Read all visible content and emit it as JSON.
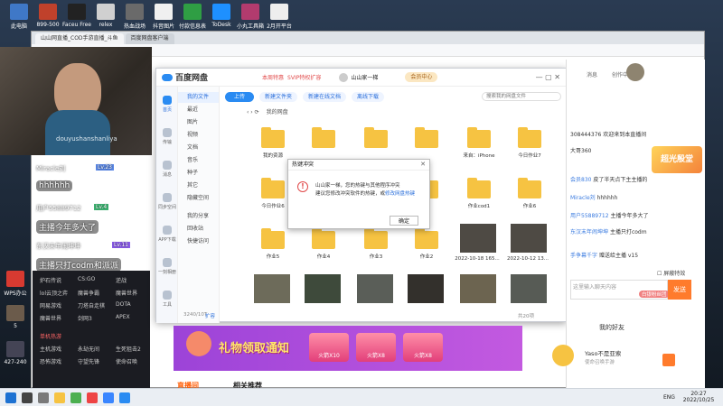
{
  "desktop": {
    "top_icons": [
      {
        "label": "此电脑",
        "color": "#3f78c7"
      },
      {
        "label": "899-500",
        "color": "#c0412b"
      },
      {
        "label": "Faceu Free",
        "color": "#222"
      },
      {
        "label": "relex",
        "color": "#d0d0d0"
      },
      {
        "label": "热血战场",
        "color": "#6a6a6a"
      },
      {
        "label": "抖音图片",
        "color": "#f0f0f0"
      },
      {
        "label": "付款信息表格",
        "color": "#2f9e44"
      },
      {
        "label": "ToDesk",
        "color": "#1e90ff"
      },
      {
        "label": "小丸工具箱",
        "color": "#b23b6e"
      },
      {
        "label": "2月开平台",
        "color": "#eeeeee"
      }
    ],
    "left_icons": [
      {
        "label": "WPS办公",
        "color": "#d73a31"
      },
      {
        "label": "5",
        "color": "#6b5b4b"
      },
      {
        "label": "427-240",
        "color": "#445"
      }
    ]
  },
  "browser": {
    "tabs": [
      {
        "label": "山山网直播_COD手游直播_斗鱼"
      },
      {
        "label": "百度网盘客户端"
      }
    ]
  },
  "stream_overlay": {
    "webcam_text": "douyushanshanliya",
    "chat": [
      {
        "user": "Miracle刘",
        "badge": "Lv.23",
        "text": "hhhhhh"
      },
      {
        "user": "用户55889712",
        "badge": "Lv.4",
        "text": "主播今年多大了"
      },
      {
        "user": "东汉末年闹坤坤",
        "badge": "Lv.11",
        "text": "主播只打codm和派派"
      }
    ]
  },
  "game_nav": {
    "rows": [
      [
        "炉石传说",
        "CS:GO",
        "逆战"
      ],
      [
        "lol云顶之弈",
        "魔兽争霸",
        "魔兽世界"
      ],
      [
        "网易游戏",
        "刀塔自走棋",
        "DOTA"
      ],
      [
        "魔兽世界",
        "剑网3",
        "APEX"
      ]
    ],
    "section": "单机热游",
    "rows2": [
      [
        "主机游戏",
        "永劫无间",
        "生死狙击2"
      ],
      [
        "恐怖游戏",
        "守望先锋",
        "使命召唤"
      ]
    ]
  },
  "pan": {
    "title": "百度网盘",
    "header_links": [
      "本周特惠",
      "SVIP特权扩容"
    ],
    "user": "山山家一梯",
    "member": "会员中心",
    "toolbar": {
      "upload": "上传",
      "new_folder": "新建文件夹",
      "new_online_doc": "新建在线文档",
      "offline_download": "离线下载",
      "search_placeholder": "搜索我的网盘文件"
    },
    "breadcrumb": "我的网盘",
    "side_nav": [
      "首页",
      "传输",
      "消息",
      "同步空间",
      "APP下载",
      "一刻相册",
      "工具"
    ],
    "nav_items": [
      "我的文件",
      "最近",
      "图片",
      "视频",
      "文档",
      "音乐",
      "种子",
      "其它",
      "隐藏空间",
      "我的分享",
      "回收站",
      "快捷访问"
    ],
    "storage": "3240/10T",
    "expand": "扩容",
    "folders": [
      {
        "label": "我的资源"
      },
      {
        "label": ""
      },
      {
        "label": ""
      },
      {
        "label": ""
      },
      {
        "label": "来自：iPhone"
      },
      {
        "label": "今日作业7"
      },
      {
        "label": "今日作业6"
      },
      {
        "label": ""
      },
      {
        "label": ""
      },
      {
        "label": ""
      },
      {
        "label": "作业cod1"
      },
      {
        "label": "作业6"
      },
      {
        "label": "作业5"
      },
      {
        "label": "作业4"
      },
      {
        "label": "作业3"
      },
      {
        "label": "作业2"
      }
    ],
    "thumbs": [
      {
        "label": "2022-10-18 165..."
      },
      {
        "label": "2022-10-12 13..."
      }
    ],
    "bottom_thumbs": [
      "",
      "",
      "",
      "",
      "",
      ""
    ],
    "item_count": "共20项"
  },
  "dialog": {
    "title": "热键冲突",
    "message": "山山家一梯，您的热键与其他程序冲突",
    "message2": "建议您修改冲突软件的热键，或",
    "link": "修改网盘热键",
    "ok": "确定"
  },
  "right_panel": {
    "top_links": [
      "消息",
      "创作中心"
    ],
    "messages": [
      {
        "user": "",
        "text": "308444376 欢迎来到本直播间"
      },
      {
        "user": "",
        "text": "大哥360"
      },
      {
        "user": "会员830",
        "text": "皮了半天点下主主播的"
      },
      {
        "user": "Miracle刘",
        "text": "hhhhhh"
      },
      {
        "user": "用户55889712",
        "text": "主播今年多大了"
      },
      {
        "user": "东汉末年闹坤坤",
        "text": "主播只打codm"
      },
      {
        "user": "手争幕千字",
        "text": "赠送给主播 v15"
      }
    ],
    "check_label": "屏蔽特效",
    "input_placeholder": "这里输入聊天内容",
    "send": "发送",
    "follow": "白银粉丝团",
    "friends": "我的好友",
    "friend": {
      "name": "Yaso不是亚索",
      "sub": "使命召唤手游"
    },
    "promo": "超光殷堂"
  },
  "banner": {
    "title": "礼物领取通知",
    "tickets": [
      "火箭X10",
      "火箭X8",
      "火箭X8"
    ]
  },
  "page_bottom": [
    "直播间",
    "相关推荐"
  ],
  "taskbar": {
    "lang": "ENG",
    "time": "20:27",
    "date": "2022/10/25"
  }
}
